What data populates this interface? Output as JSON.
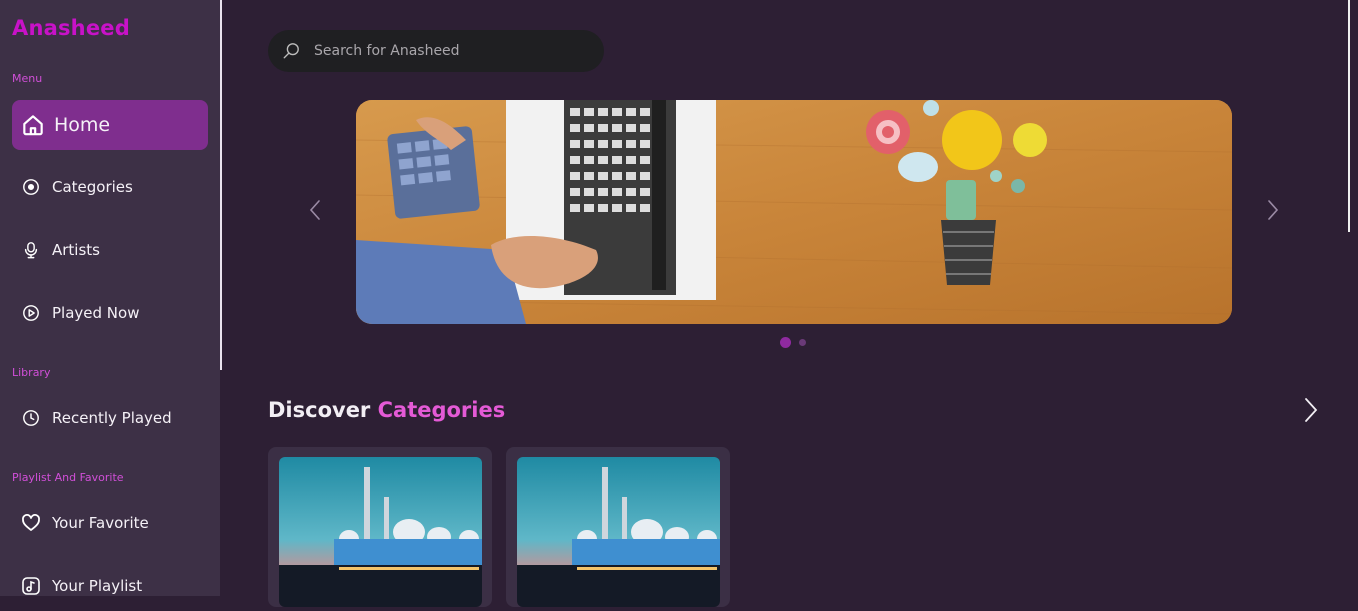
{
  "app": {
    "logo": "Anasheed"
  },
  "sidebar": {
    "menu_label": "Menu",
    "library_label": "Library",
    "playlist_label": "Playlist And Favorite",
    "items": {
      "home": "Home",
      "categories": "Categories",
      "artists": "Artists",
      "played_now": "Played Now",
      "recently_played": "Recently Played",
      "your_favorite": "Your Favorite",
      "your_playlist": "Your Playlist"
    }
  },
  "search": {
    "placeholder": "Search for Anasheed",
    "value": ""
  },
  "carousel": {
    "slide_count": 2,
    "active_slide": 1,
    "prev_icon": "chevron-left-icon",
    "next_icon": "chevron-right-icon"
  },
  "discover": {
    "title_plain": "Discover",
    "title_accent": "Categories",
    "next_icon": "chevron-right-icon"
  },
  "colors": {
    "background": "#2d1f34",
    "sidebar": "#3d3046",
    "accent": "#c812c8",
    "active_nav": "#7f2e8e",
    "highlight_text": "#e45ad6"
  }
}
